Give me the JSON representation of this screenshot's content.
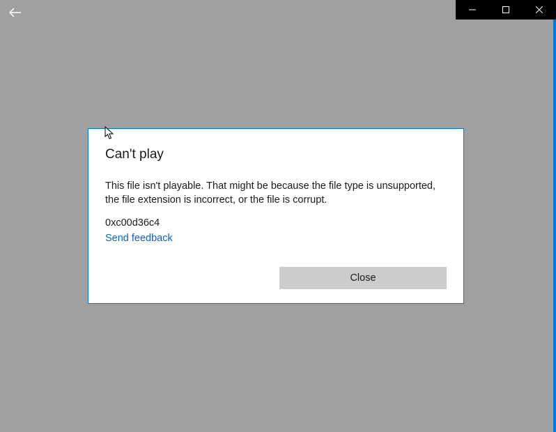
{
  "dialog": {
    "title": "Can't play",
    "message": "This file isn't playable. That might be because the file type is unsupported, the file extension is incorrect, or the file is corrupt.",
    "error_code": "0xc00d36c4",
    "feedback_link": "Send feedback",
    "close_label": "Close"
  }
}
